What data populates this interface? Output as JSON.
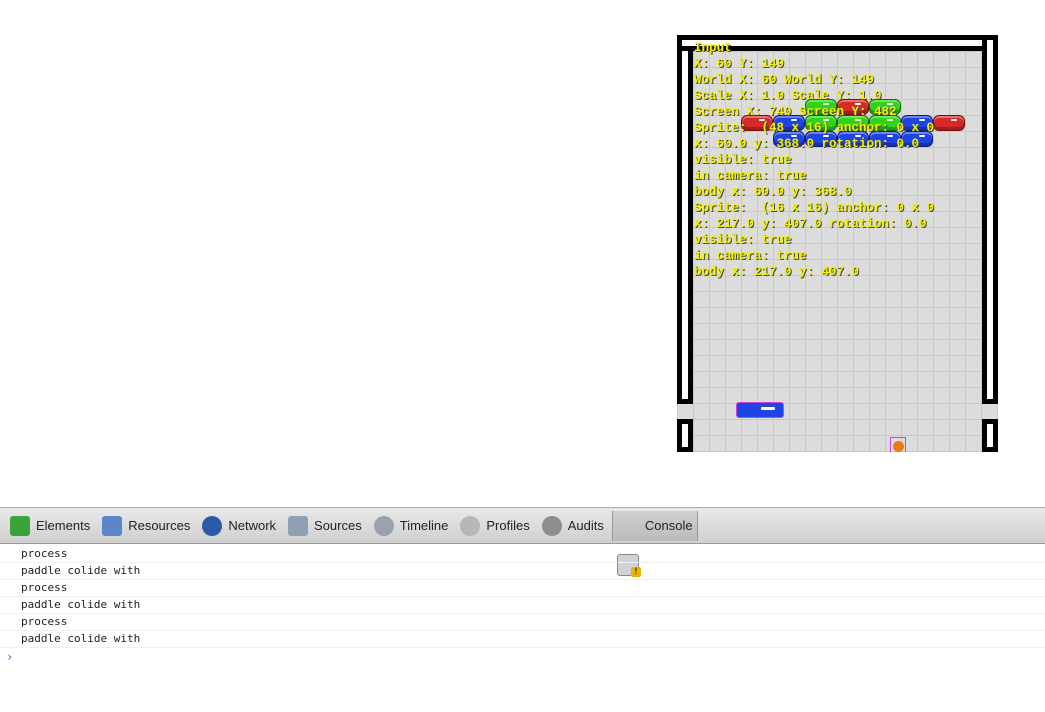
{
  "game": {
    "debug_lines": [
      "Input",
      "X: 60 Y: 149",
      "World X: 60 World Y: 149",
      "Scale X: 1.0 Scale Y: 1.0",
      "Screen X: 740 Screen Y: 482",
      "Sprite:  (48 x 16) anchor: 0 x 0",
      "x: 60.0 y: 368.0 rotation: 0.0",
      "visible: true",
      "in camera: true",
      "body x: 60.0 y: 368.0",
      "Sprite:  (16 x 16) anchor: 0 x 0",
      "x: 217.0 y: 407.0 rotation: 0.0",
      "visible: true",
      "in camera: true",
      "body x: 217.0 y: 407.0"
    ],
    "colors": {
      "debug_text": "#f1f100",
      "red_brick": "#d42a2a",
      "green_brick": "#2fd31a",
      "blue_brick": "#1e44e6",
      "ball": "#f07a10",
      "debug_outline": "#d042d6"
    }
  },
  "devtools": {
    "tabs": [
      {
        "label": "Elements",
        "icon": "elements-icon"
      },
      {
        "label": "Resources",
        "icon": "resources-icon"
      },
      {
        "label": "Network",
        "icon": "network-icon"
      },
      {
        "label": "Sources",
        "icon": "sources-icon"
      },
      {
        "label": "Timeline",
        "icon": "timeline-icon"
      },
      {
        "label": "Profiles",
        "icon": "profiles-icon"
      },
      {
        "label": "Audits",
        "icon": "audits-icon"
      },
      {
        "label": "Console",
        "icon": "console-icon"
      }
    ],
    "active_tab": "Console",
    "console_lines": [
      "process",
      "paddle colide with",
      "process",
      "paddle colide with",
      "process",
      "paddle colide with"
    ],
    "prompt_symbol": "›"
  }
}
